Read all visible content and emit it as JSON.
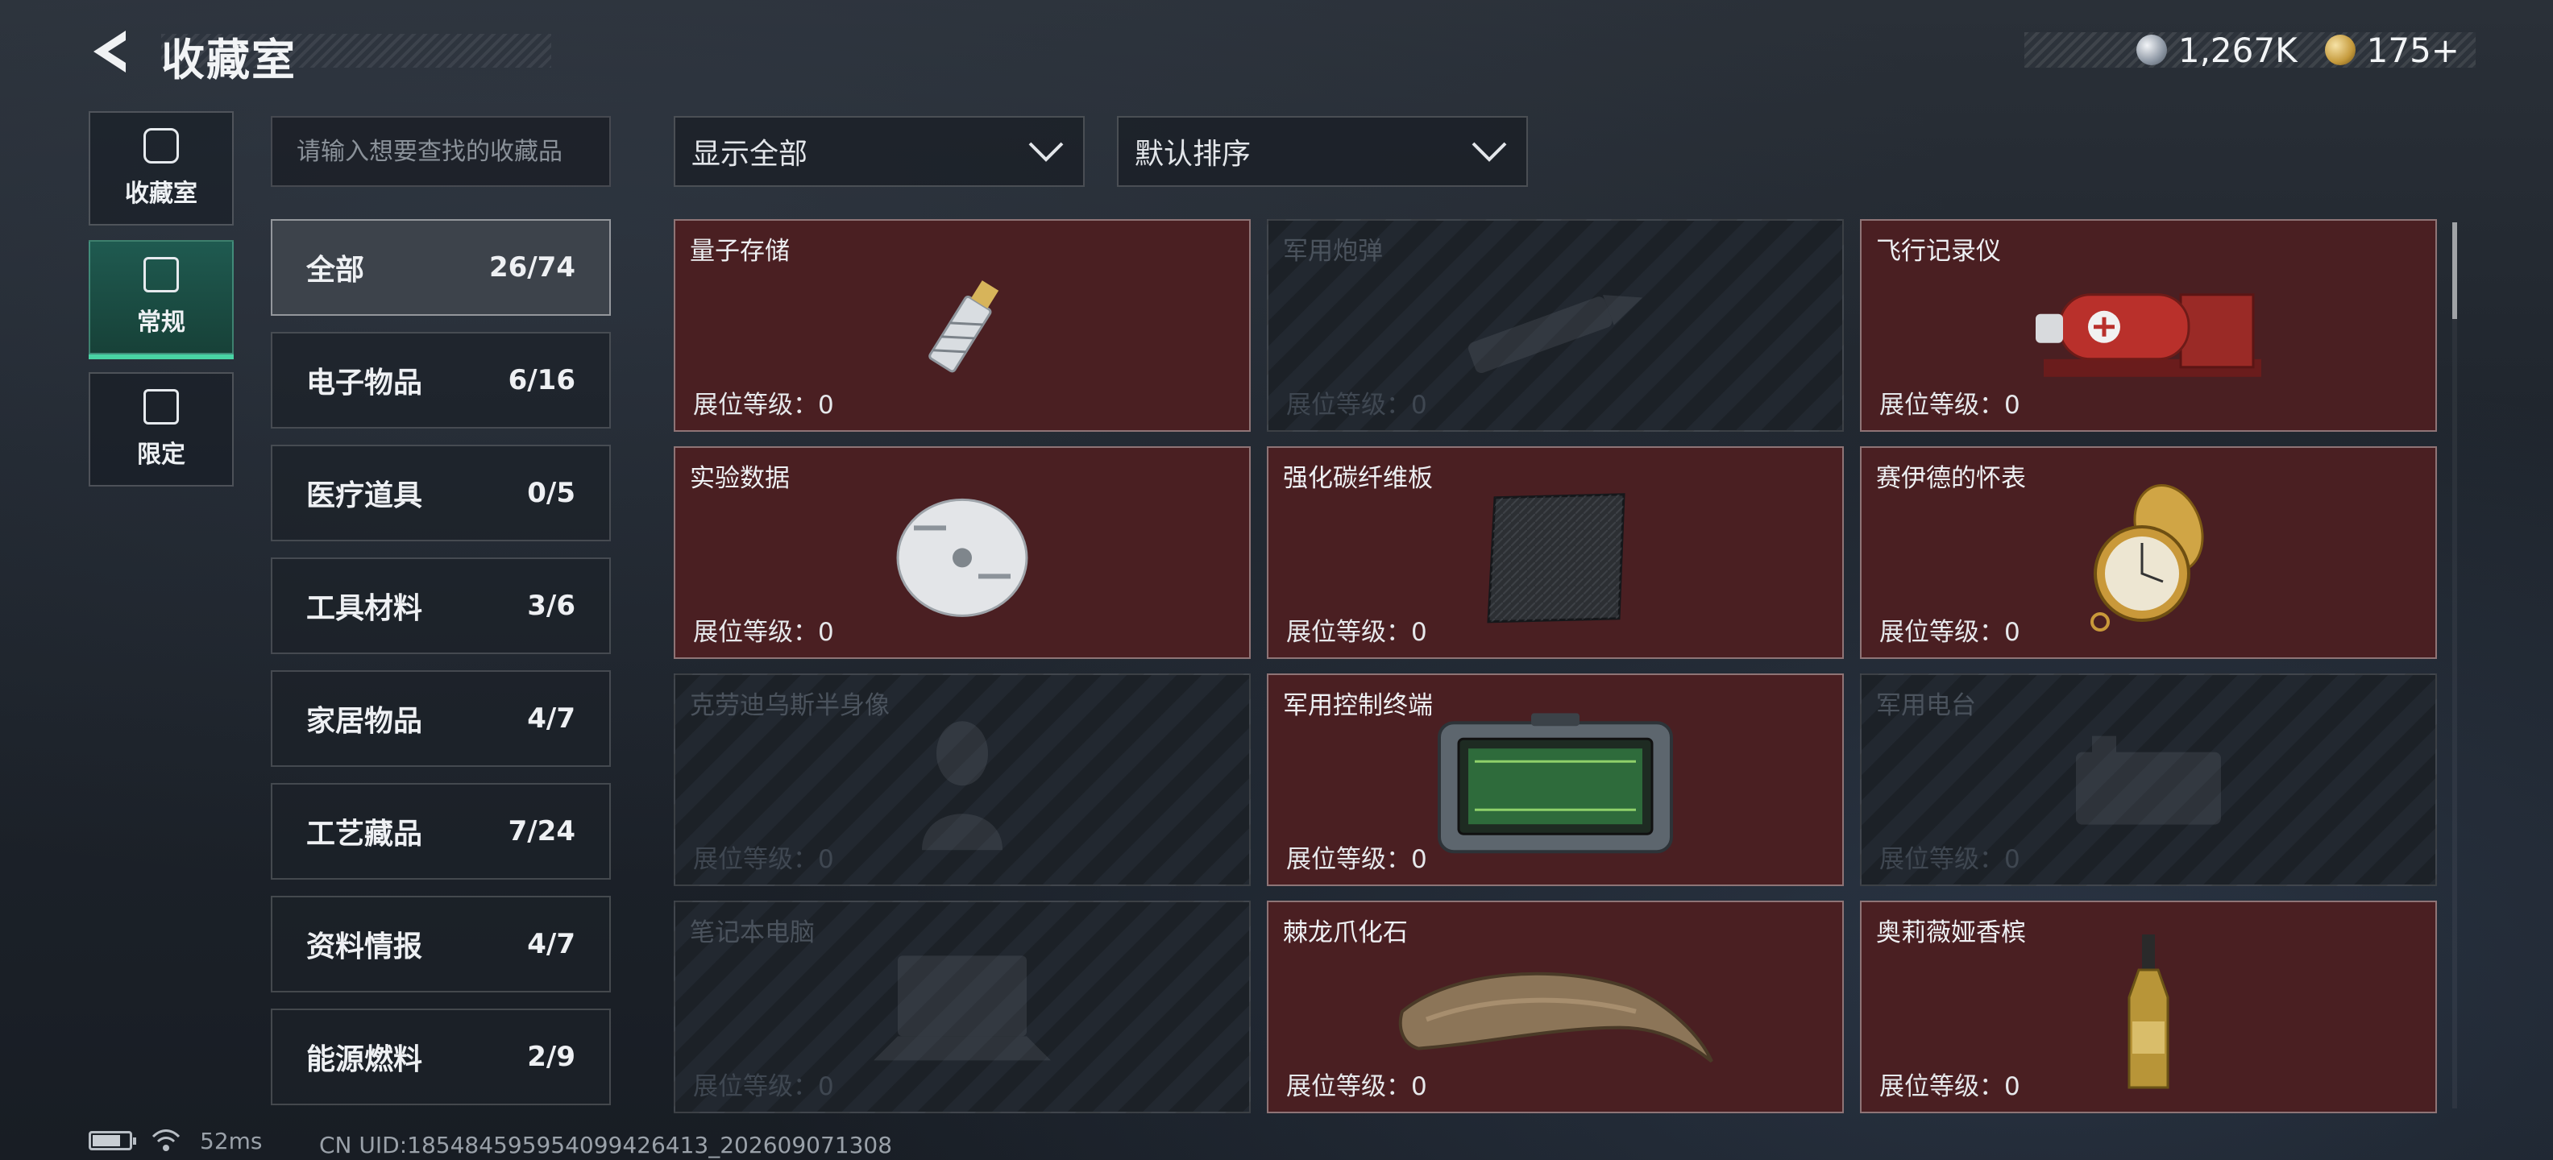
{
  "header": {
    "title": "收藏室"
  },
  "currency": {
    "silver": "1,267K",
    "gold": "175+"
  },
  "rail": [
    {
      "label": "收藏室",
      "icon": "vault-icon"
    },
    {
      "label": "常规",
      "icon": "photo-frame-icon",
      "active": true
    },
    {
      "label": "限定",
      "icon": "limited-frame-icon"
    }
  ],
  "search": {
    "placeholder": "请输入想要查找的收藏品"
  },
  "categories": [
    {
      "label": "全部",
      "count": "26/74",
      "active": true
    },
    {
      "label": "电子物品",
      "count": "6/16"
    },
    {
      "label": "医疗道具",
      "count": "0/5"
    },
    {
      "label": "工具材料",
      "count": "3/6"
    },
    {
      "label": "家居物品",
      "count": "4/7"
    },
    {
      "label": "工艺藏品",
      "count": "7/24"
    },
    {
      "label": "资料情报",
      "count": "4/7"
    },
    {
      "label": "能源燃料",
      "count": "2/9"
    }
  ],
  "filters": {
    "show": "显示全部",
    "sort": "默认排序"
  },
  "items": [
    {
      "name": "量子存储",
      "level": "展位等级：0",
      "locked": false,
      "icon": "usb-drive-icon"
    },
    {
      "name": "军用炮弹",
      "level": "展位等级：0",
      "locked": true,
      "icon": "artillery-shell-icon"
    },
    {
      "name": "飞行记录仪",
      "level": "展位等级：0",
      "locked": false,
      "icon": "flight-recorder-icon"
    },
    {
      "name": "实验数据",
      "level": "展位等级：0",
      "locked": false,
      "icon": "disc-icon"
    },
    {
      "name": "强化碳纤维板",
      "level": "展位等级：0",
      "locked": false,
      "icon": "carbon-plate-icon"
    },
    {
      "name": "赛伊德的怀表",
      "level": "展位等级：0",
      "locked": false,
      "icon": "pocket-watch-icon"
    },
    {
      "name": "克劳迪乌斯半身像",
      "level": "展位等级：0",
      "locked": true,
      "icon": "bust-icon"
    },
    {
      "name": "军用控制终端",
      "level": "展位等级：0",
      "locked": false,
      "icon": "control-terminal-icon"
    },
    {
      "name": "军用电台",
      "level": "展位等级：0",
      "locked": true,
      "icon": "radio-icon"
    },
    {
      "name": "笔记本电脑",
      "level": "展位等级：0",
      "locked": true,
      "icon": "laptop-icon"
    },
    {
      "name": "棘龙爪化石",
      "level": "展位等级：0",
      "locked": false,
      "icon": "claw-fossil-icon"
    },
    {
      "name": "奥莉薇娅香槟",
      "level": "展位等级：0",
      "locked": false,
      "icon": "champagne-icon"
    }
  ],
  "status": {
    "ping": "52ms",
    "uid": "CN UID:18548459595409942641​3_202609071308"
  }
}
